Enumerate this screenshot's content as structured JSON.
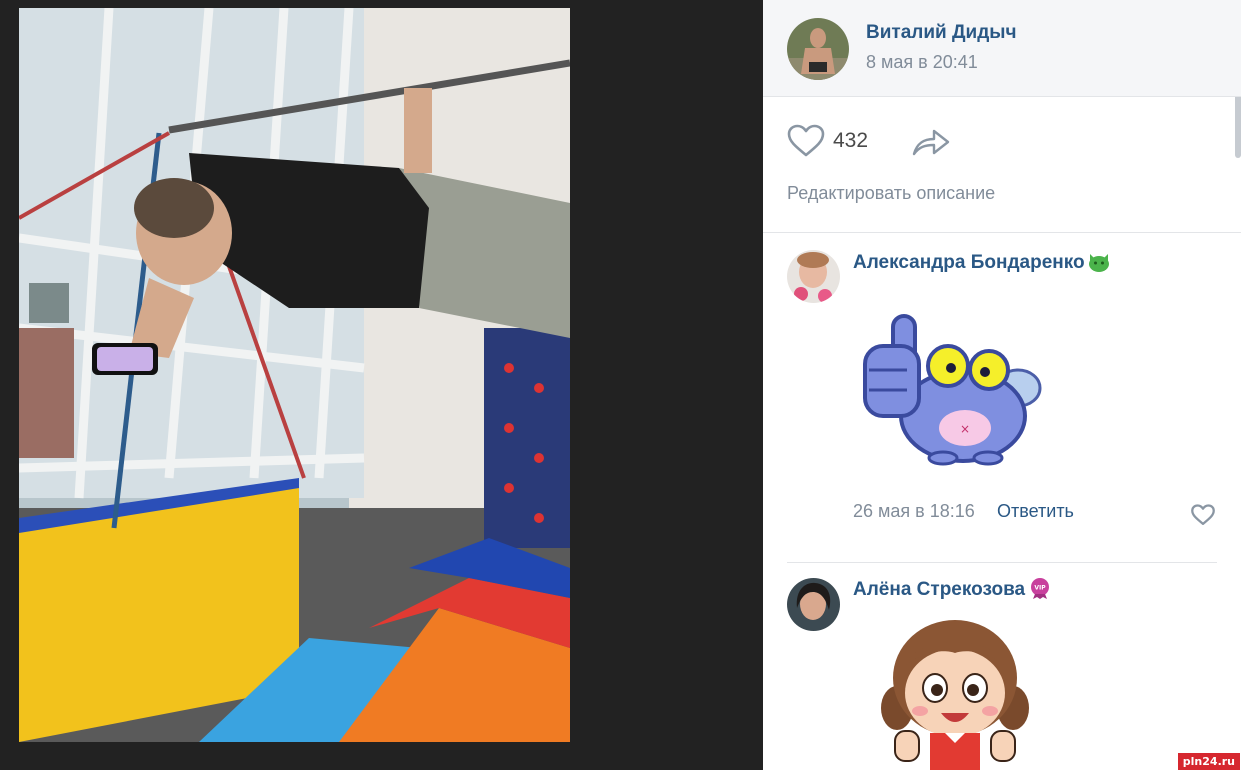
{
  "post": {
    "author_name": "Виталий Дидыч",
    "date": "8 мая в 20:41",
    "likes": "432",
    "edit_description": "Редактировать описание",
    "photo_description": ""
  },
  "comments": [
    {
      "name": "Александра Бондаренко",
      "badge_icon": "cat-face-icon",
      "sticker": "thumbs-up-fly-sticker",
      "date": "26 мая в 18:16",
      "reply": "Ответить"
    },
    {
      "name": "Алёна Стрекозова",
      "badge_icon": "vip-badge-icon",
      "sticker": "girl-thumbs-up-sticker"
    }
  ],
  "icons": {
    "like": "heart-outline-icon",
    "share": "share-arrow-icon"
  },
  "watermark": "pln24.ru",
  "colors": {
    "link": "#2a5885",
    "meta": "#818c99",
    "backdrop": "#222222"
  }
}
